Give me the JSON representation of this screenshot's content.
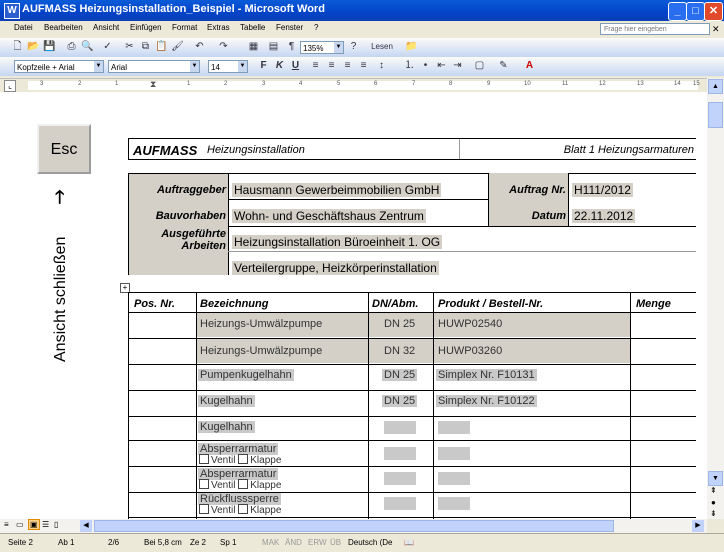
{
  "window": {
    "title": "AUFMASS Heizungsinstallation_Beispiel - Microsoft Word"
  },
  "menu": {
    "items": [
      "Datei",
      "Bearbeiten",
      "Ansicht",
      "Einfügen",
      "Format",
      "Extras",
      "Tabelle",
      "Fenster",
      "?"
    ],
    "help_placeholder": "Frage hier eingeben"
  },
  "toolbar": {
    "zoom": "135%",
    "read_label": "Lesen",
    "style": "Kopfzeile + Arial",
    "font": "Arial",
    "size": "14"
  },
  "ruler": {
    "marks": [
      "3",
      "2",
      "1",
      "1",
      "2",
      "3",
      "4",
      "5",
      "6",
      "7",
      "8",
      "9",
      "10",
      "11",
      "12",
      "13",
      "14",
      "15"
    ]
  },
  "sidepanel": {
    "esc_label": "Esc",
    "close_view_label": "Ansicht schließen"
  },
  "document": {
    "header": {
      "title": "AUFMASS",
      "subtitle": "Heizungsinstallation",
      "sheet": "Blatt 1 Heizungsarmaturen"
    },
    "info": {
      "client_label": "Auftraggeber",
      "client_value": "Hausmann Gewerbeimmobilien GmbH",
      "order_label": "Auftrag Nr.",
      "order_value": "H111/2012",
      "project_label": "Bauvorhaben",
      "project_value": "Wohn- und Geschäftshaus Zentrum",
      "date_label": "Datum",
      "date_value": "22.11.2012",
      "works_label": "Ausgeführte Arbeiten",
      "works_value_1": "Heizungsinstallation Büroeinheit 1. OG",
      "works_value_2": "Verteilergruppe, Heizkörperinstallation"
    },
    "table": {
      "headers": [
        "Pos. Nr.",
        "Bezeichnung",
        "DN/Abm.",
        "Produkt / Bestell-Nr.",
        "Menge"
      ],
      "rows": [
        {
          "name": "Heizungs-Umwälzpumpe",
          "dn": "DN 25",
          "product": "HUWP02540"
        },
        {
          "name": "Heizungs-Umwälzpumpe",
          "dn": "DN 32",
          "product": "HUWP03260"
        },
        {
          "name": "Pumpenkugelhahn",
          "dn": "DN 25",
          "product": "Simplex Nr. F10131"
        },
        {
          "name": "Kugelhahn",
          "dn": "DN 25",
          "product": "Simplex Nr. F10122"
        },
        {
          "name": "Kugelhahn",
          "dn": "",
          "product": ""
        },
        {
          "name": "Absperrarmatur",
          "dn": "",
          "product": "",
          "opt1": "Ventil",
          "opt2": "Klappe"
        },
        {
          "name": "Absperrarmatur",
          "dn": "",
          "product": "",
          "opt1": "Ventil",
          "opt2": "Klappe"
        },
        {
          "name": "Rückflusssperre",
          "dn": "",
          "product": "",
          "opt1": "Ventil",
          "opt2": "Klappe"
        }
      ]
    }
  },
  "status": {
    "page": "Seite 2",
    "section": "Ab 1",
    "pages": "2/6",
    "at": "Bei 5,8 cm",
    "line": "Ze 2",
    "col": "Sp 1",
    "modes": [
      "MAK",
      "ÄND",
      "ERW",
      "ÜB"
    ],
    "language": "Deutsch (De"
  }
}
